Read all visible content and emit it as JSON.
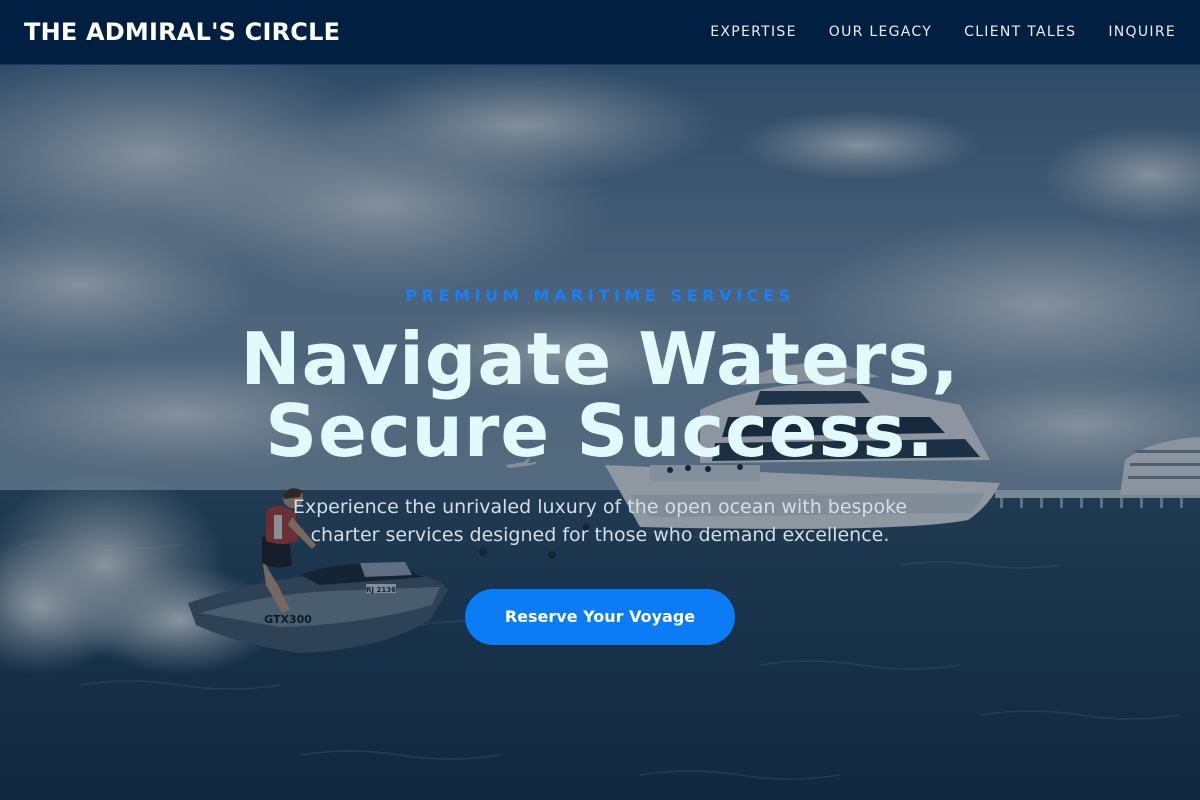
{
  "header": {
    "brand": "THE ADMIRAL'S CIRCLE",
    "nav": [
      {
        "label": "EXPERTISE"
      },
      {
        "label": "OUR LEGACY"
      },
      {
        "label": "CLIENT TALES"
      },
      {
        "label": "INQUIRE"
      }
    ]
  },
  "hero": {
    "eyebrow": "PREMIUM MARITIME SERVICES",
    "headline_line1": "Navigate Waters,",
    "headline_line2": "Secure Success.",
    "lede_line1": "Experience the unrivaled luxury of the open ocean with bespoke",
    "lede_line2": "charter services designed for those who demand excellence.",
    "cta_label": "Reserve Your Voyage",
    "jet_ski_hull_text": "GTX300",
    "jet_ski_registration": "RJ 2136"
  },
  "colors": {
    "header_bg": "#011f41",
    "accent": "#0b7cf5",
    "eyebrow": "#1a7ff2",
    "headline": "#e3fafd",
    "body_text": "#d6dde6"
  }
}
